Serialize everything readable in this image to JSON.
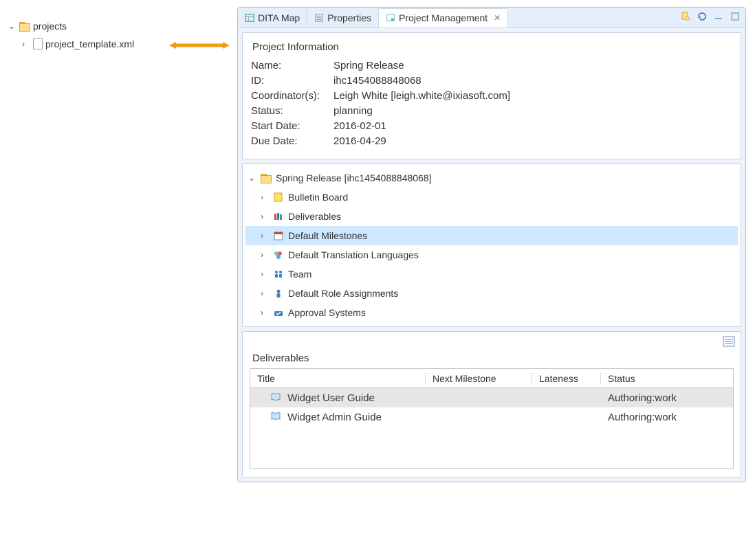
{
  "leftTree": {
    "root": "projects",
    "child": "project_template.xml"
  },
  "tabs": {
    "t0": {
      "label": "DITA Map"
    },
    "t1": {
      "label": "Properties"
    },
    "t2": {
      "label": "Project Management"
    }
  },
  "projectInfo": {
    "sectionTitle": "Project Information",
    "nameLabel": "Name:",
    "nameValue": "Spring Release",
    "idLabel": "ID:",
    "idValue": "ihc1454088848068",
    "coordLabel": "Coordinator(s):",
    "coordValue": "Leigh White [leigh.white@ixiasoft.com]",
    "statusLabel": "Status:",
    "statusValue": "planning",
    "startLabel": "Start Date:",
    "startValue": "2016-02-01",
    "dueLabel": "Due Date:",
    "dueValue": "2016-04-29"
  },
  "projectTree": {
    "root": "Spring Release [ihc1454088848068]",
    "n0": "Bulletin Board",
    "n1": "Deliverables",
    "n2": "Default Milestones",
    "n3": "Default Translation Languages",
    "n4": "Team",
    "n5": "Default Role Assignments",
    "n6": "Approval Systems"
  },
  "deliverables": {
    "title": "Deliverables",
    "headers": {
      "title": "Title",
      "next": "Next Milestone",
      "late": "Lateness",
      "status": "Status"
    },
    "rows": [
      {
        "title": "Widget User Guide",
        "next": "",
        "late": "",
        "status": "Authoring:work"
      },
      {
        "title": "Widget Admin Guide",
        "next": "",
        "late": "",
        "status": "Authoring:work"
      }
    ]
  }
}
